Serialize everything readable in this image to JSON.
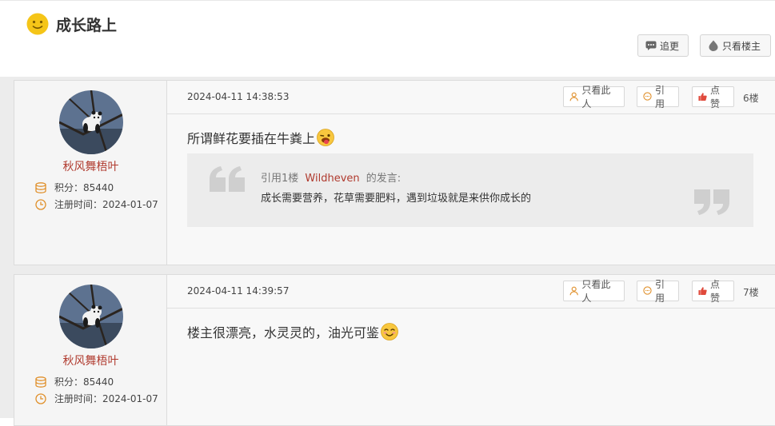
{
  "header": {
    "title": "成长路上",
    "title_icon": "smiley-face-icon",
    "reply_button": "追更",
    "owner_only_button": "只看楼主"
  },
  "colors": {
    "accent": "#b03a2e",
    "title_icon": "#f5c518"
  },
  "posts": [
    {
      "author": {
        "name": "秋风舞梧叶",
        "score_label": "积分：",
        "score": "85440",
        "reg_label": "注册时间：",
        "reg_date": "2024-01-07"
      },
      "time": "2024-04-11 14:38:53",
      "actions": {
        "only_author": "只看此人",
        "quote": "引用",
        "like": "点赞"
      },
      "floor": "6楼",
      "text": "所谓鲜花要插在牛粪上",
      "emoji": "tongue-wink-emoji",
      "quote": {
        "prefix": "引用1楼",
        "user": "Wildheven",
        "suffix": "的发言:",
        "body": "成长需要营养，花草需要肥料，遇到垃圾就是来供你成长的"
      }
    },
    {
      "author": {
        "name": "秋风舞梧叶",
        "score_label": "积分：",
        "score": "85440",
        "reg_label": "注册时间：",
        "reg_date": "2024-01-07"
      },
      "time": "2024-04-11 14:39:57",
      "actions": {
        "only_author": "只看此人",
        "quote": "引用",
        "like": "点赞"
      },
      "floor": "7楼",
      "text": "楼主很漂亮，水灵灵的，油光可鉴",
      "emoji": "blush-smile-emoji"
    }
  ]
}
